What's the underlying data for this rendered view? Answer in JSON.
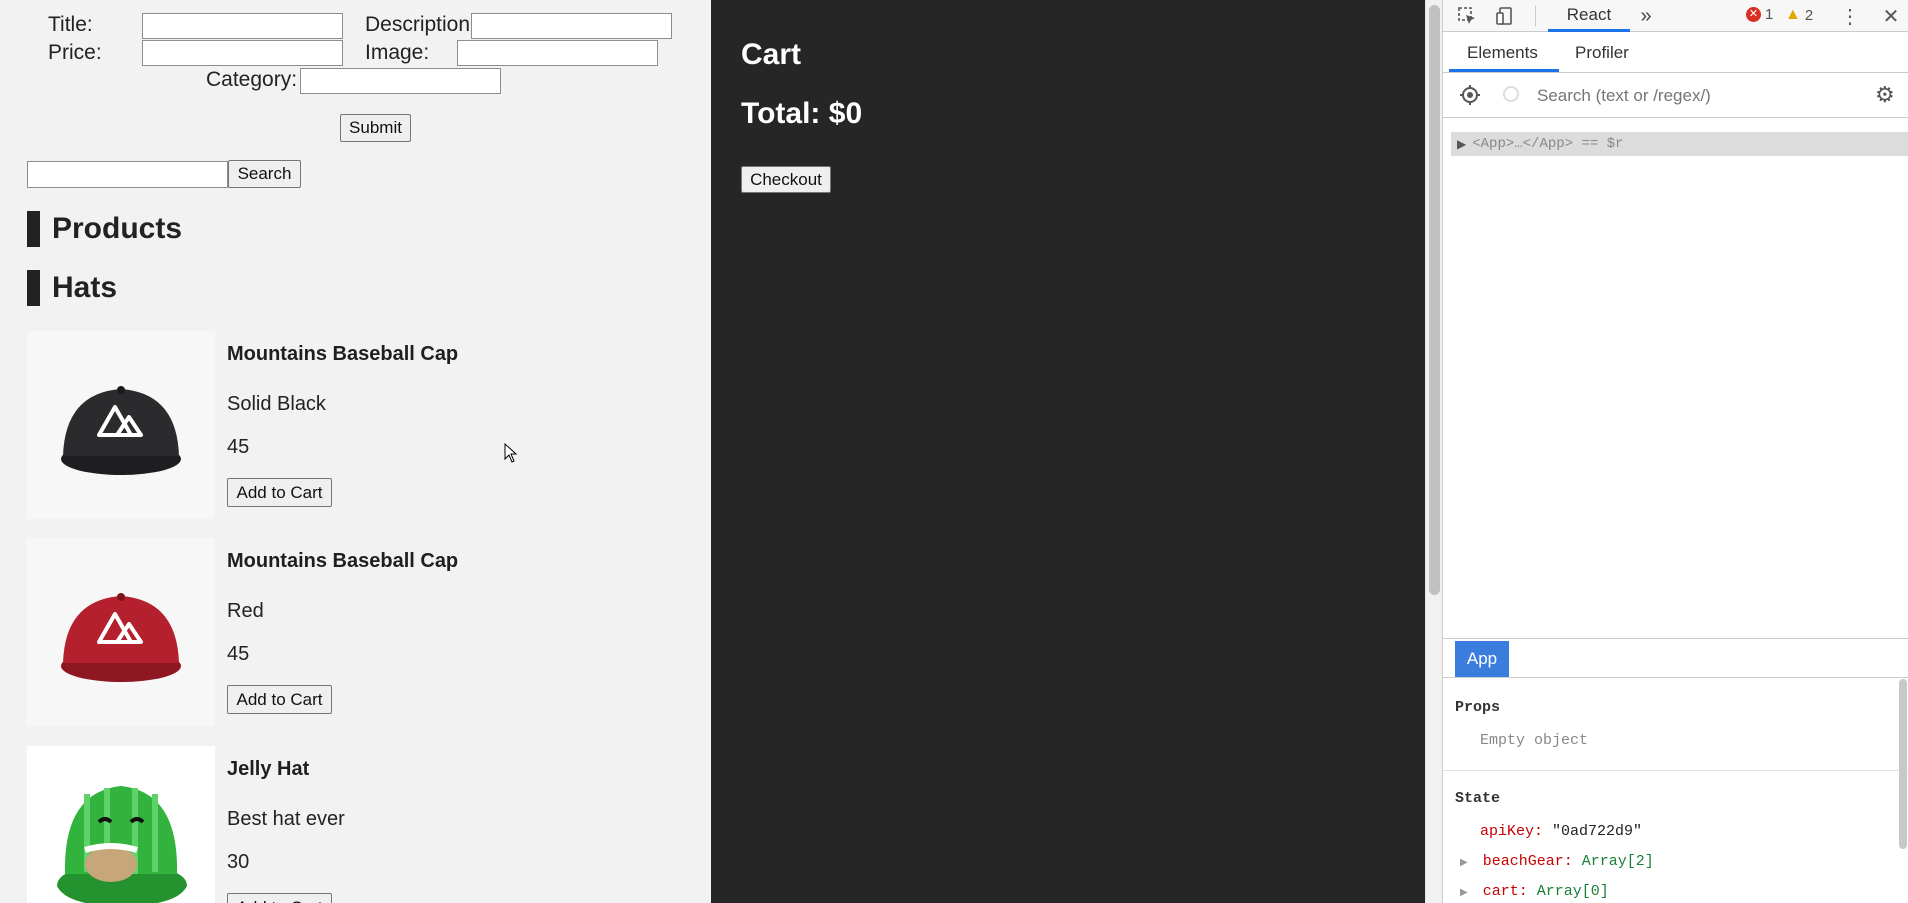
{
  "form": {
    "title_label": "Title:",
    "description_label": "Description:",
    "price_label": "Price:",
    "image_label": "Image:",
    "category_label": "Category:",
    "submit_label": "Submit"
  },
  "search": {
    "button_label": "Search"
  },
  "sections": {
    "products": "Products",
    "hats": "Hats"
  },
  "products": [
    {
      "title": "Mountains Baseball Cap",
      "description": "Solid Black",
      "price": "45",
      "add_label": "Add to Cart",
      "cap_color": "#2b2b2e"
    },
    {
      "title": "Mountains Baseball Cap",
      "description": "Red",
      "price": "45",
      "add_label": "Add to Cart",
      "cap_color": "#b5202e"
    },
    {
      "title": "Jelly Hat",
      "description": "Best hat ever",
      "price": "30",
      "add_label": "Add to Cart",
      "cap_color": "#2fa83b"
    }
  ],
  "cart": {
    "title": "Cart",
    "total": "Total: $0",
    "checkout_label": "Checkout"
  },
  "devtools": {
    "tab_react": "React",
    "error_count": "1",
    "warning_count": "2",
    "subtab_elements": "Elements",
    "subtab_profiler": "Profiler",
    "search_placeholder": "Search (text or /regex/)",
    "tree_node": "<App>…</App> == $r",
    "selected_component": "App",
    "props_heading": "Props",
    "props_empty": "Empty object",
    "state_heading": "State",
    "state": [
      {
        "key": "apiKey:",
        "value": "\"0ad722d9\""
      },
      {
        "key": "beachGear:",
        "value": "Array[2]"
      },
      {
        "key": "cart:",
        "value": "Array[0]"
      }
    ]
  }
}
